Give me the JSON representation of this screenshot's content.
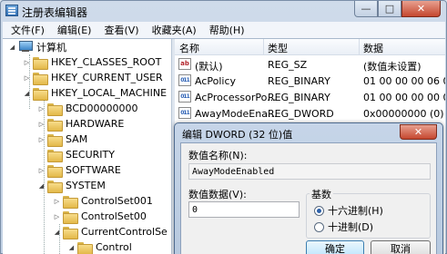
{
  "window": {
    "title": "注册表编辑器",
    "minimize_glyph": "—",
    "maximize_glyph": "□",
    "close_glyph": "✕"
  },
  "menu": [
    "文件(F)",
    "编辑(E)",
    "查看(V)",
    "收藏夹(A)",
    "帮助(H)"
  ],
  "tree": {
    "root": "计算机",
    "items": [
      {
        "label": "HKEY_CLASSES_ROOT",
        "expander": "▷",
        "icon": "folder-icon"
      },
      {
        "label": "HKEY_CURRENT_USER",
        "expander": "▷",
        "icon": "folder-icon"
      },
      {
        "label": "HKEY_LOCAL_MACHINE",
        "expander": "◢",
        "icon": "folder-icon"
      },
      {
        "label": "BCD00000000",
        "expander": "▷",
        "icon": "folder-icon"
      },
      {
        "label": "HARDWARE",
        "expander": "▷",
        "icon": "folder-icon"
      },
      {
        "label": "SAM",
        "expander": "▷",
        "icon": "folder-icon"
      },
      {
        "label": "SECURITY",
        "expander": "",
        "icon": "folder-icon"
      },
      {
        "label": "SOFTWARE",
        "expander": "▷",
        "icon": "folder-icon"
      },
      {
        "label": "SYSTEM",
        "expander": "◢",
        "icon": "folder-icon"
      },
      {
        "label": "ControlSet001",
        "expander": "▷",
        "icon": "folder-icon"
      },
      {
        "label": "ControlSet00",
        "expander": "▷",
        "icon": "folder-icon"
      },
      {
        "label": "CurrentControlSe",
        "expander": "◢",
        "icon": "folder-icon"
      },
      {
        "label": "Control",
        "expander": "◢",
        "icon": "folder-icon"
      }
    ]
  },
  "list": {
    "columns": [
      "名称",
      "类型",
      "数据"
    ],
    "rows": [
      {
        "name": "(默认)",
        "type": "REG_SZ",
        "data": "(数值未设置)",
        "icon": "string-value-icon",
        "icon_text": "ab"
      },
      {
        "name": "AcPolicy",
        "type": "REG_BINARY",
        "data": "01 00 00 00 06 0",
        "icon": "binary-value-icon",
        "icon_text": "011"
      },
      {
        "name": "AcProcessorPo...",
        "type": "REG_BINARY",
        "data": "01 00 00 00 00 0",
        "icon": "binary-value-icon",
        "icon_text": "011"
      },
      {
        "name": "AwayModeEna...",
        "type": "REG_DWORD",
        "data": "0x00000000 (0)",
        "icon": "binary-value-icon",
        "icon_text": "011"
      }
    ]
  },
  "dialog": {
    "title": "编辑 DWORD (32 位)值",
    "close_glyph": "✕",
    "value_name_label": "数值名称(N):",
    "value_name": "AwayModeEnabled",
    "value_data_label": "数值数据(V):",
    "value_data": "0",
    "base_label": "基数",
    "base_options": [
      {
        "label": "十六进制(H)",
        "checked": true
      },
      {
        "label": "十进制(D)",
        "checked": false
      }
    ],
    "ok_label": "确定",
    "cancel_label": "取消"
  }
}
